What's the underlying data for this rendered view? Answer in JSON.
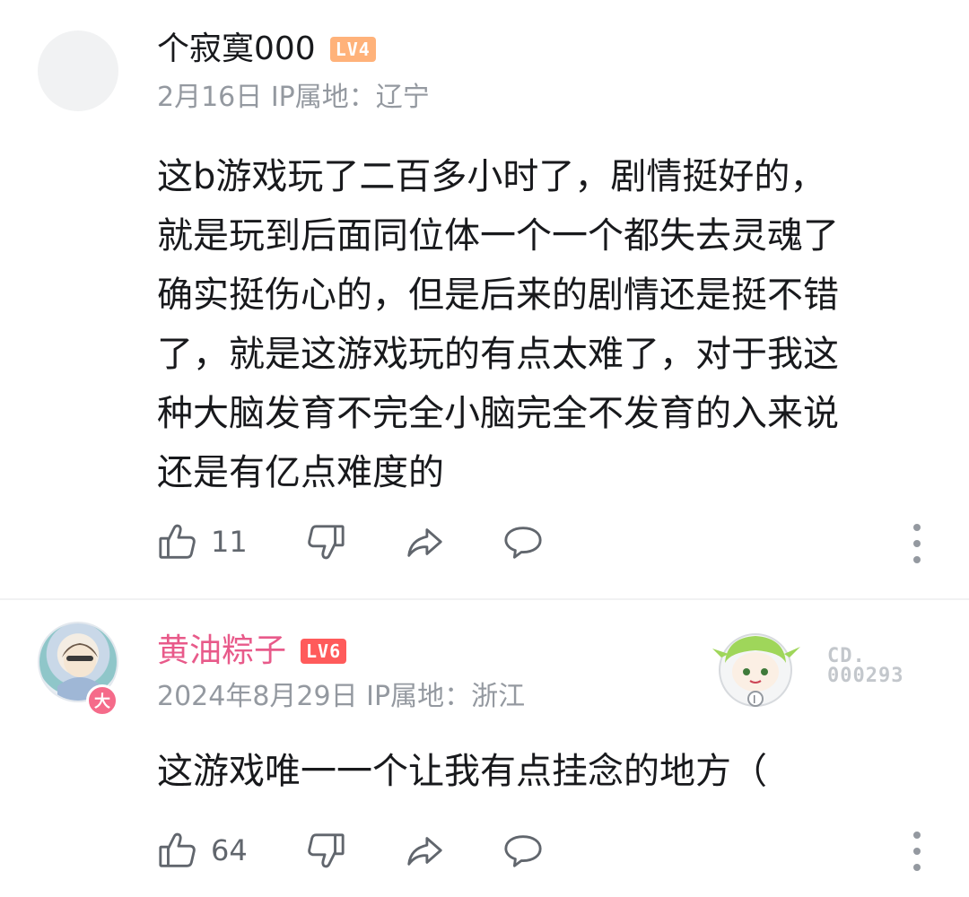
{
  "comments": [
    {
      "username": "个寂寞000",
      "level": "LV4",
      "date": "2月16日",
      "ip_location": "IP属地：辽宁",
      "text": "这b游戏玩了二百多小时了，剧情挺好的，\n就是玩到后面同位体一个一个都失去灵魂了\n确实挺伤心的，但是后来的剧情还是挺不错\n了，就是这游戏玩的有点太难了，对于我这\n种大脑发育不完全小脑完全不发育的入来说\n还是有亿点难度的",
      "like_count": "11",
      "username_color": "#18191c"
    },
    {
      "username": "黄油粽子",
      "level": "LV6",
      "date": "2024年8月29日",
      "ip_location": "IP属地：浙江",
      "text": "这游戏唯一一个让我有点挂念的地方（",
      "like_count": "64",
      "avatar_badge": "大",
      "fan_card": "CD.\n000293",
      "username_color": "#e85a8a"
    }
  ],
  "icons": [
    "like-icon",
    "dislike-icon",
    "share-icon",
    "reply-icon",
    "more-icon"
  ]
}
